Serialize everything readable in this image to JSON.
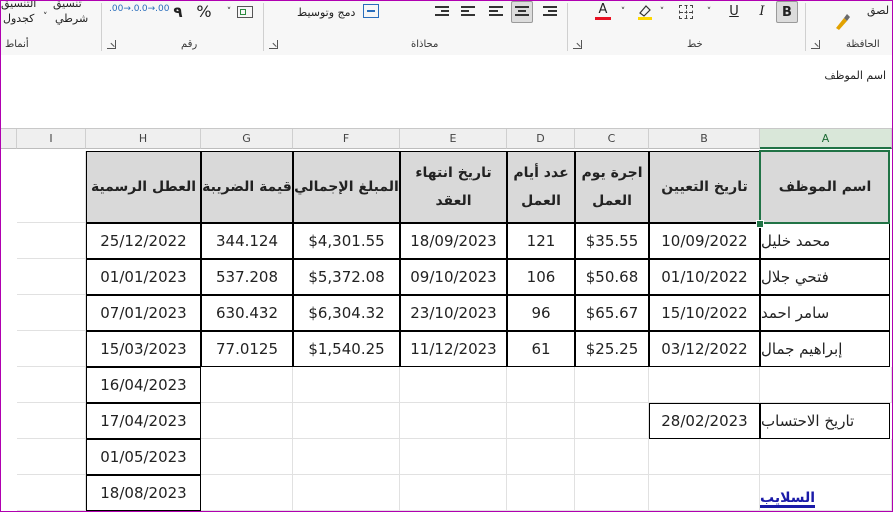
{
  "ribbon": {
    "clipboard": {
      "paste_label": "لصق",
      "group_label": "الحافظة"
    },
    "font": {
      "group_label": "خط",
      "bold_label": "B",
      "italic_label": "I",
      "underline_label": "U",
      "font_color": "#e81123",
      "highlight_color": "#ffd800"
    },
    "alignment": {
      "group_label": "محاذاة",
      "merge_label": "دمج وتوسيط"
    },
    "number": {
      "group_label": "رقم",
      "percent_label": "%",
      "comma_label": "٩",
      "increase_decimal_label": ".00→.0",
      "decrease_decimal_label": ".0→.00"
    },
    "styles": {
      "group_label": "أنماط",
      "conditional_line1": "تنسيق",
      "conditional_line2": "شرطي",
      "table_line1": "التنسيق",
      "table_line2": "كجدول"
    }
  },
  "formula_bar": {
    "content": "اسم الموظف"
  },
  "columns": [
    "A",
    "B",
    "C",
    "D",
    "E",
    "F",
    "G",
    "H",
    "I"
  ],
  "selected_column": "A",
  "headers": {
    "A": "اسم الموظف",
    "B": "تاريخ التعيين",
    "C1": "اجرة يوم",
    "C2": "العمل",
    "D1": "عدد أيام",
    "D2": "العمل",
    "E1": "تاريخ انتهاء",
    "E2": "العقد",
    "F": "المبلغ الإجمالي",
    "G": "قيمة الضريبة",
    "H": "العطل الرسمية"
  },
  "rows": [
    {
      "name": "محمد خليل",
      "hire_date": "10/09/2022",
      "daily_wage": "$35.55",
      "days": "121",
      "end_date": "18/09/2023",
      "total": "$4,301.55",
      "tax": "344.124",
      "holiday": "25/12/2022"
    },
    {
      "name": "فتحي جلال",
      "hire_date": "01/10/2022",
      "daily_wage": "$50.68",
      "days": "106",
      "end_date": "09/10/2023",
      "total": "$5,372.08",
      "tax": "537.208",
      "holiday": "01/01/2023"
    },
    {
      "name": "سامر احمد",
      "hire_date": "15/10/2022",
      "daily_wage": "$65.67",
      "days": "96",
      "end_date": "23/10/2023",
      "total": "$6,304.32",
      "tax": "630.432",
      "holiday": "07/01/2023"
    },
    {
      "name": "إبراهيم جمال",
      "hire_date": "03/12/2022",
      "daily_wage": "$25.25",
      "days": "61",
      "end_date": "11/12/2023",
      "total": "$1,540.25",
      "tax": "77.0125",
      "holiday": "15/03/2023"
    }
  ],
  "extra_holidays": [
    "16/04/2023",
    "17/04/2023",
    "01/05/2023",
    "18/08/2023"
  ],
  "calc_date": {
    "label": "تاريخ الاحتساب",
    "value": "28/02/2023"
  },
  "bottom_label": "السلايب"
}
